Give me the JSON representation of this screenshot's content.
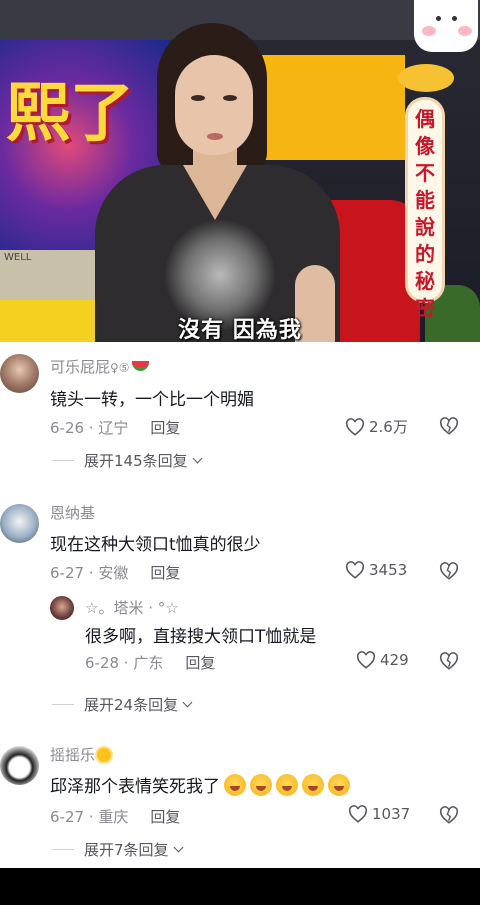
{
  "video": {
    "subtitle": "沒有 因為我",
    "show_title": "偶像不能說的秘密",
    "screen_text": "熙了",
    "desk_label": "WELL"
  },
  "comments": [
    {
      "username": "可乐屁屁",
      "user_badge": "♀⑤",
      "text": "镜头一转，一个比一个明媚",
      "date_location": "6-26 · 辽宁",
      "reply_label": "回复",
      "likes": "2.6万",
      "expand_label": "展开145条回复"
    },
    {
      "username": "恩纳基",
      "text": "现在这种大领口t恤真的很少",
      "date_location": "6-27 · 安徽",
      "reply_label": "回复",
      "likes": "3453",
      "sub_reply": {
        "username": "☆。塔米 · °☆",
        "text": "很多啊，直接搜大领口T恤就是",
        "date_location": "6-28 · 广东",
        "reply_label": "回复",
        "likes": "429"
      },
      "expand_label": "展开24条回复"
    },
    {
      "username": "摇摇乐",
      "text": "邱泽那个表情笑死我了",
      "date_location": "6-27 · 重庆",
      "reply_label": "回复",
      "likes": "1037",
      "expand_label": "展开7条回复"
    }
  ],
  "icons": {
    "like": "heart-outline-icon",
    "dislike": "broken-heart-icon",
    "expand": "chevron-down-icon"
  },
  "colors": {
    "text_primary": "#161823",
    "text_secondary": "#8a8b91",
    "action": "#57585f"
  }
}
